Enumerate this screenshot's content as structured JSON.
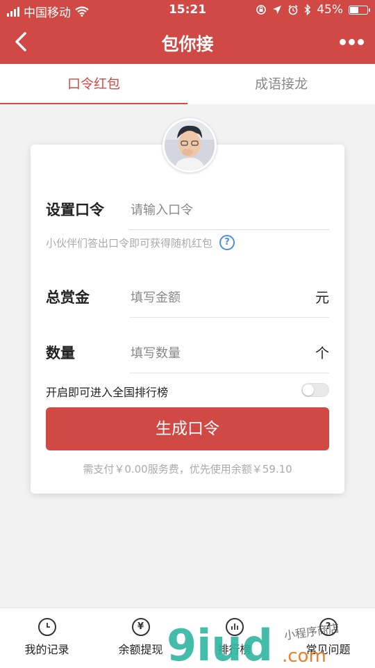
{
  "status_bar": {
    "carrier": "中国移动",
    "time": "15:21",
    "battery": "45%",
    "battery_level": 0.45
  },
  "navbar": {
    "title": "包你接"
  },
  "tabs": [
    {
      "label": "口令红包",
      "active": true
    },
    {
      "label": "成语接龙",
      "active": false
    }
  ],
  "form": {
    "password_label": "设置口令",
    "password_placeholder": "请输入口令",
    "hint": "小伙伴们答出口令即可获得随机红包",
    "amount_label": "总赏金",
    "amount_placeholder": "填写金额",
    "amount_unit": "元",
    "count_label": "数量",
    "count_placeholder": "填写数量",
    "count_unit": "个",
    "rank_label": "开启即可进入全国排行榜",
    "rank_enabled": false,
    "submit_label": "生成口令",
    "pay_note": "需支付￥0.00服务费，优先使用余额￥59.10"
  },
  "bottom_nav": [
    {
      "label": "我的记录",
      "icon": "clock-icon"
    },
    {
      "label": "余额提现",
      "icon": "yen-icon"
    },
    {
      "label": "排行榜",
      "icon": "chart-icon"
    },
    {
      "label": "常见问题",
      "icon": "question-icon"
    }
  ],
  "watermark": {
    "text": "9iud.com",
    "subtext": "小程序商店"
  },
  "colors": {
    "primary": "#d04944",
    "background": "#f2f2f2",
    "hint": "#aaaaaa",
    "link_blue": "#4a90e2"
  }
}
